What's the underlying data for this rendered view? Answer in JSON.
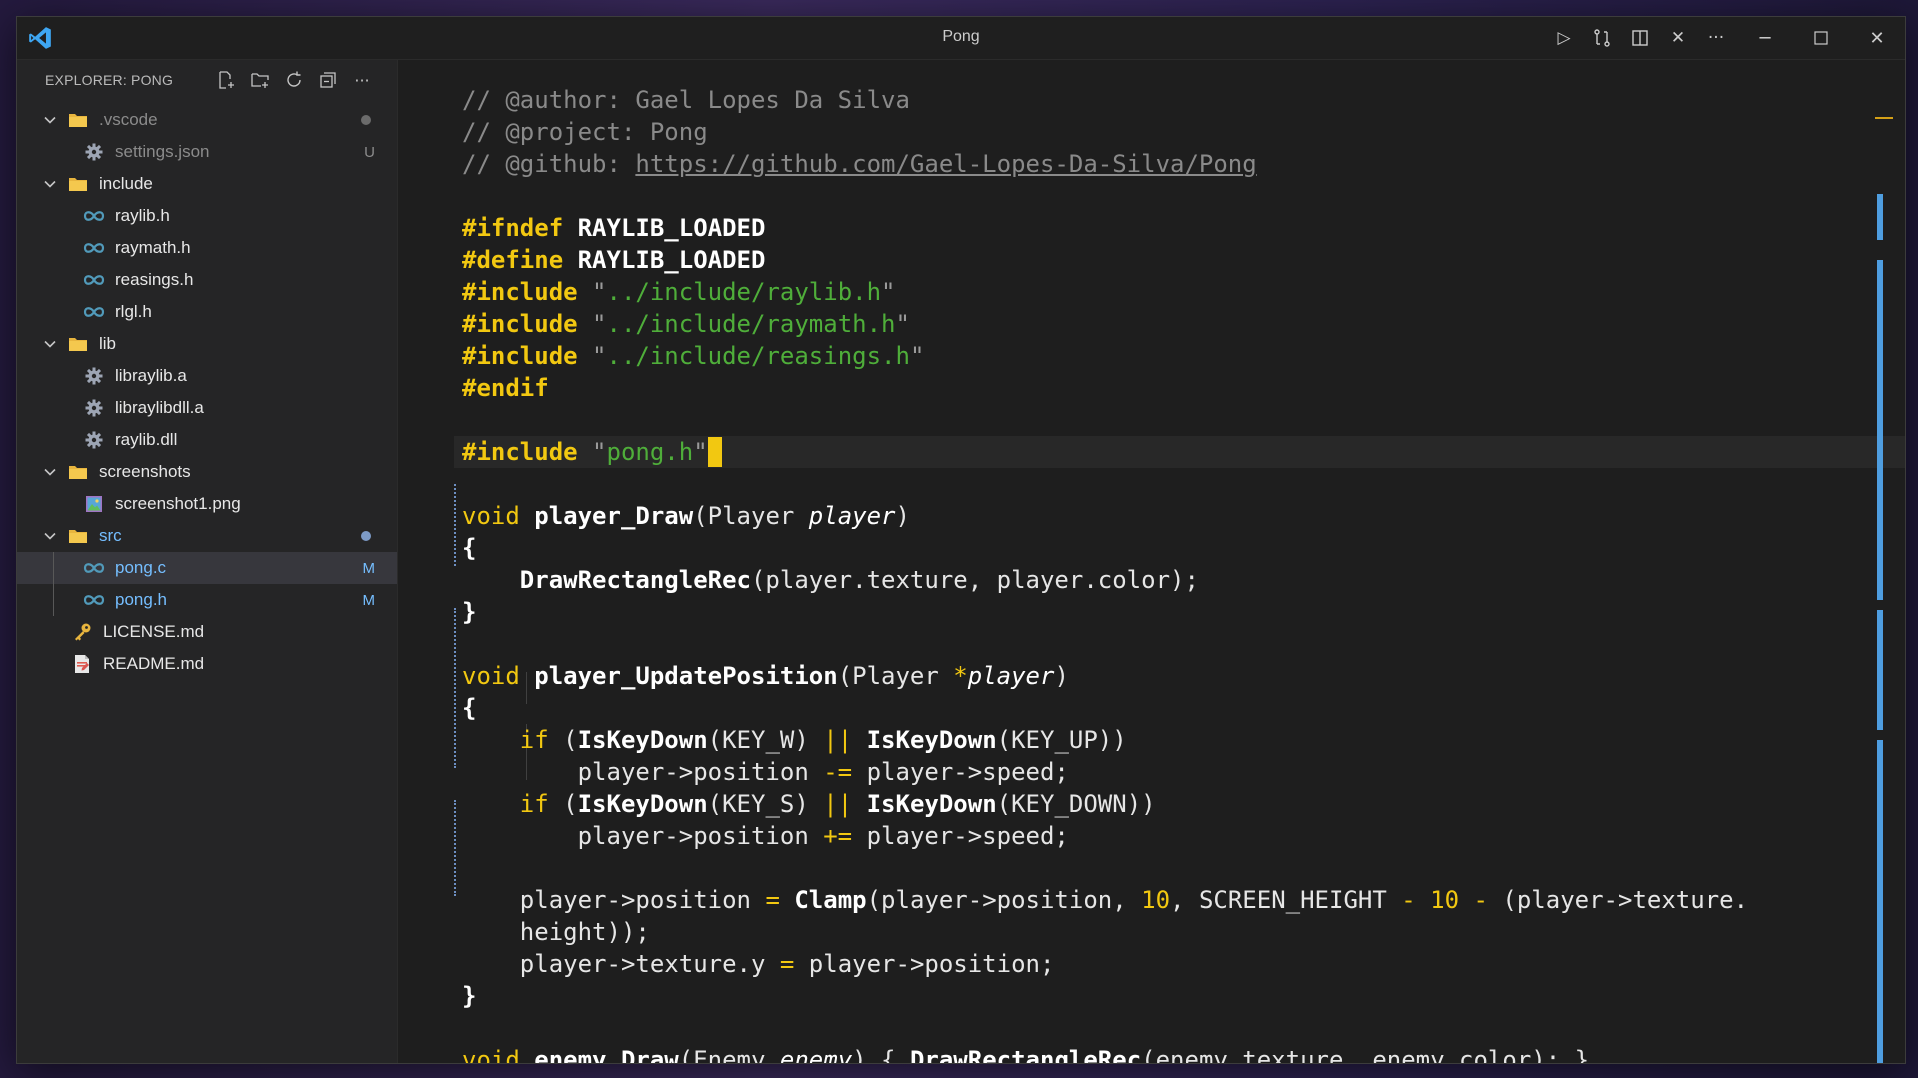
{
  "window": {
    "title": "Pong",
    "controls": {
      "minimize": "─",
      "maximize": "☐",
      "close": "✕"
    },
    "actions": {
      "run": "▷",
      "compare": "⇄",
      "split": "◫",
      "close_editor": "✕",
      "more": "···"
    }
  },
  "explorer": {
    "title": "EXPLORER: PONG",
    "actions": [
      "new-file",
      "new-folder",
      "refresh",
      "collapse-all",
      "more"
    ],
    "more_label": "···",
    "tree": [
      {
        "label": ".vscode",
        "type": "folder",
        "level": 0,
        "status": "dot-gray",
        "dim": true
      },
      {
        "label": "settings.json",
        "type": "gear",
        "level": 1,
        "badge": "U",
        "dim": true
      },
      {
        "label": "include",
        "type": "folder",
        "level": 0
      },
      {
        "label": "raylib.h",
        "type": "c-header",
        "level": 1
      },
      {
        "label": "raymath.h",
        "type": "c-header",
        "level": 1
      },
      {
        "label": "reasings.h",
        "type": "c-header",
        "level": 1
      },
      {
        "label": "rlgl.h",
        "type": "c-header",
        "level": 1
      },
      {
        "label": "lib",
        "type": "folder",
        "level": 0
      },
      {
        "label": "libraylib.a",
        "type": "gear",
        "level": 1
      },
      {
        "label": "libraylibdll.a",
        "type": "gear",
        "level": 1
      },
      {
        "label": "raylib.dll",
        "type": "gear",
        "level": 1
      },
      {
        "label": "screenshots",
        "type": "folder",
        "level": 0
      },
      {
        "label": "screenshot1.png",
        "type": "image",
        "level": 1
      },
      {
        "label": "src",
        "type": "folder",
        "level": 0,
        "status": "dot-blue",
        "blue": true
      },
      {
        "label": "pong.c",
        "type": "c-source",
        "level": 1,
        "badge": "M",
        "selected": true,
        "blue": true
      },
      {
        "label": "pong.h",
        "type": "c-header",
        "level": 1,
        "badge": "M",
        "blue": true
      },
      {
        "label": "LICENSE.md",
        "type": "license",
        "level": "file0"
      },
      {
        "label": "README.md",
        "type": "markdown",
        "level": "file0"
      }
    ]
  },
  "editor": {
    "lines": [
      [
        [
          "c-com",
          "// @author: Gael Lopes Da Silva"
        ]
      ],
      [
        [
          "c-com",
          "// @project: Pong"
        ]
      ],
      [
        [
          "c-com",
          "// @github: "
        ],
        [
          "c-link",
          "https://github.com/Gael-Lopes-Da-Silva/Pong"
        ]
      ],
      [],
      [
        [
          "c-dir",
          "#ifndef"
        ],
        [
          "c-punc",
          " "
        ],
        [
          "c-macro",
          "RAYLIB_LOADED"
        ]
      ],
      [
        [
          "c-dir",
          "#define"
        ],
        [
          "c-punc",
          " "
        ],
        [
          "c-macro",
          "RAYLIB_LOADED"
        ]
      ],
      [
        [
          "c-dir",
          "#include"
        ],
        [
          "c-punc",
          " "
        ],
        [
          "c-q",
          "\""
        ],
        [
          "c-str",
          "../include/raylib.h"
        ],
        [
          "c-q",
          "\""
        ]
      ],
      [
        [
          "c-dir",
          "#include"
        ],
        [
          "c-punc",
          " "
        ],
        [
          "c-q",
          "\""
        ],
        [
          "c-str",
          "../include/raymath.h"
        ],
        [
          "c-q",
          "\""
        ]
      ],
      [
        [
          "c-dir",
          "#include"
        ],
        [
          "c-punc",
          " "
        ],
        [
          "c-q",
          "\""
        ],
        [
          "c-str",
          "../include/reasings.h"
        ],
        [
          "c-q",
          "\""
        ]
      ],
      [
        [
          "c-dir",
          "#endif"
        ]
      ],
      [],
      [
        [
          "c-dir",
          "#include"
        ],
        [
          "c-punc",
          " "
        ],
        [
          "c-q",
          "\""
        ],
        [
          "c-str",
          "pong.h"
        ],
        [
          "c-q",
          "\""
        ],
        [
          "cursor",
          ""
        ]
      ],
      [],
      [
        [
          "c-kw",
          "void"
        ],
        [
          "c-punc",
          " "
        ],
        [
          "c-fn",
          "player_Draw"
        ],
        [
          "c-punc",
          "(Player "
        ],
        [
          "c-param",
          "player"
        ],
        [
          "c-punc",
          ")"
        ]
      ],
      [
        [
          "c-brace",
          "{"
        ]
      ],
      [
        [
          "c-punc",
          "    "
        ],
        [
          "c-fn",
          "DrawRectangleRec"
        ],
        [
          "c-punc",
          "(player.texture, player.color);"
        ]
      ],
      [
        [
          "c-brace",
          "}"
        ]
      ],
      [],
      [
        [
          "c-kw",
          "void"
        ],
        [
          "c-punc",
          " "
        ],
        [
          "c-fn",
          "player_UpdatePosition"
        ],
        [
          "c-punc",
          "(Player "
        ],
        [
          "c-op",
          "*"
        ],
        [
          "c-param",
          "player"
        ],
        [
          "c-punc",
          ")"
        ]
      ],
      [
        [
          "c-brace",
          "{"
        ]
      ],
      [
        [
          "c-punc",
          "    "
        ],
        [
          "c-kw",
          "if"
        ],
        [
          "c-punc",
          " ("
        ],
        [
          "c-fn",
          "IsKeyDown"
        ],
        [
          "c-punc",
          "(KEY_W) "
        ],
        [
          "c-op",
          "||"
        ],
        [
          "c-punc",
          " "
        ],
        [
          "c-fn",
          "IsKeyDown"
        ],
        [
          "c-punc",
          "(KEY_UP))"
        ]
      ],
      [
        [
          "c-punc",
          "        player->position "
        ],
        [
          "c-op",
          "-="
        ],
        [
          "c-punc",
          " player->speed;"
        ]
      ],
      [
        [
          "c-punc",
          "    "
        ],
        [
          "c-kw",
          "if"
        ],
        [
          "c-punc",
          " ("
        ],
        [
          "c-fn",
          "IsKeyDown"
        ],
        [
          "c-punc",
          "(KEY_S) "
        ],
        [
          "c-op",
          "||"
        ],
        [
          "c-punc",
          " "
        ],
        [
          "c-fn",
          "IsKeyDown"
        ],
        [
          "c-punc",
          "(KEY_DOWN))"
        ]
      ],
      [
        [
          "c-punc",
          "        player->position "
        ],
        [
          "c-op",
          "+="
        ],
        [
          "c-punc",
          " player->speed;"
        ]
      ],
      [],
      [
        [
          "c-punc",
          "    player->position "
        ],
        [
          "c-op",
          "="
        ],
        [
          "c-punc",
          " "
        ],
        [
          "c-fn",
          "Clamp"
        ],
        [
          "c-punc",
          "(player->position, "
        ],
        [
          "c-num",
          "10"
        ],
        [
          "c-punc",
          ", SCREEN_HEIGHT "
        ],
        [
          "c-op",
          "-"
        ],
        [
          "c-punc",
          " "
        ],
        [
          "c-num",
          "10"
        ],
        [
          "c-punc",
          " "
        ],
        [
          "c-op",
          "-"
        ],
        [
          "c-punc",
          " (player->texture."
        ]
      ],
      [
        [
          "c-punc",
          "    height));"
        ]
      ],
      [
        [
          "c-punc",
          "    player->texture.y "
        ],
        [
          "c-op",
          "="
        ],
        [
          "c-punc",
          " player->position;"
        ]
      ],
      [
        [
          "c-brace",
          "}"
        ]
      ],
      [],
      [
        [
          "c-kw",
          "void"
        ],
        [
          "c-punc",
          " "
        ],
        [
          "c-fn",
          "enemy_Draw"
        ],
        [
          "c-punc",
          "(Enemy "
        ],
        [
          "c-param",
          "enemy"
        ],
        [
          "c-punc",
          ") { "
        ],
        [
          "c-fn",
          "DrawRectangleRec"
        ],
        [
          "c-punc",
          "(enemy.texture, enemy.color); }"
        ]
      ]
    ]
  }
}
